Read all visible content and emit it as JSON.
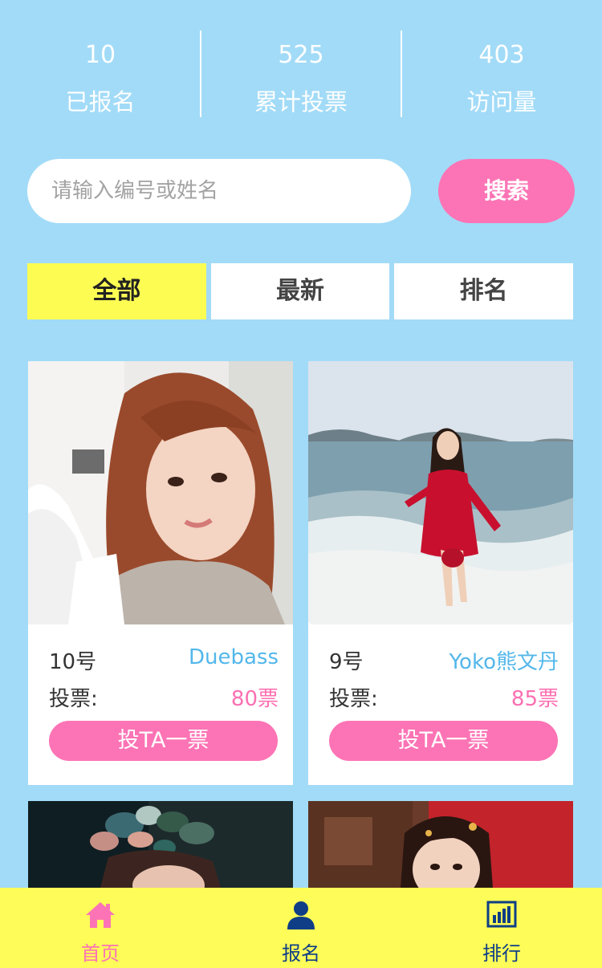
{
  "stats": [
    {
      "value": "10",
      "label": "已报名"
    },
    {
      "value": "525",
      "label": "累计投票"
    },
    {
      "value": "403",
      "label": "访问量"
    }
  ],
  "search": {
    "placeholder": "请输入编号或姓名",
    "button_label": "搜索"
  },
  "tabs": [
    {
      "label": "全部",
      "active": true
    },
    {
      "label": "最新",
      "active": false
    },
    {
      "label": "排名",
      "active": false
    }
  ],
  "cards": [
    {
      "number": "10号",
      "name": "Duebass",
      "votes_label": "投票:",
      "votes": "80票",
      "vote_button": "投TA一票"
    },
    {
      "number": "9号",
      "name": "Yoko熊文丹",
      "votes_label": "投票:",
      "votes": "85票",
      "vote_button": "投TA一票"
    },
    {
      "number": "",
      "name": "",
      "votes_label": "",
      "votes": "",
      "vote_button": ""
    },
    {
      "number": "",
      "name": "",
      "votes_label": "",
      "votes": "",
      "vote_button": ""
    }
  ],
  "nav": [
    {
      "label": "首页",
      "icon": "home-icon",
      "active": true
    },
    {
      "label": "报名",
      "icon": "user-icon",
      "active": false
    },
    {
      "label": "排行",
      "icon": "bar-chart-icon",
      "active": false
    }
  ],
  "colors": {
    "background": "#a2dbf7",
    "accent_pink": "#fc74b5",
    "accent_yellow": "#fdfc53",
    "name_blue": "#53b7ea",
    "nav_blue": "#0f3e86"
  }
}
